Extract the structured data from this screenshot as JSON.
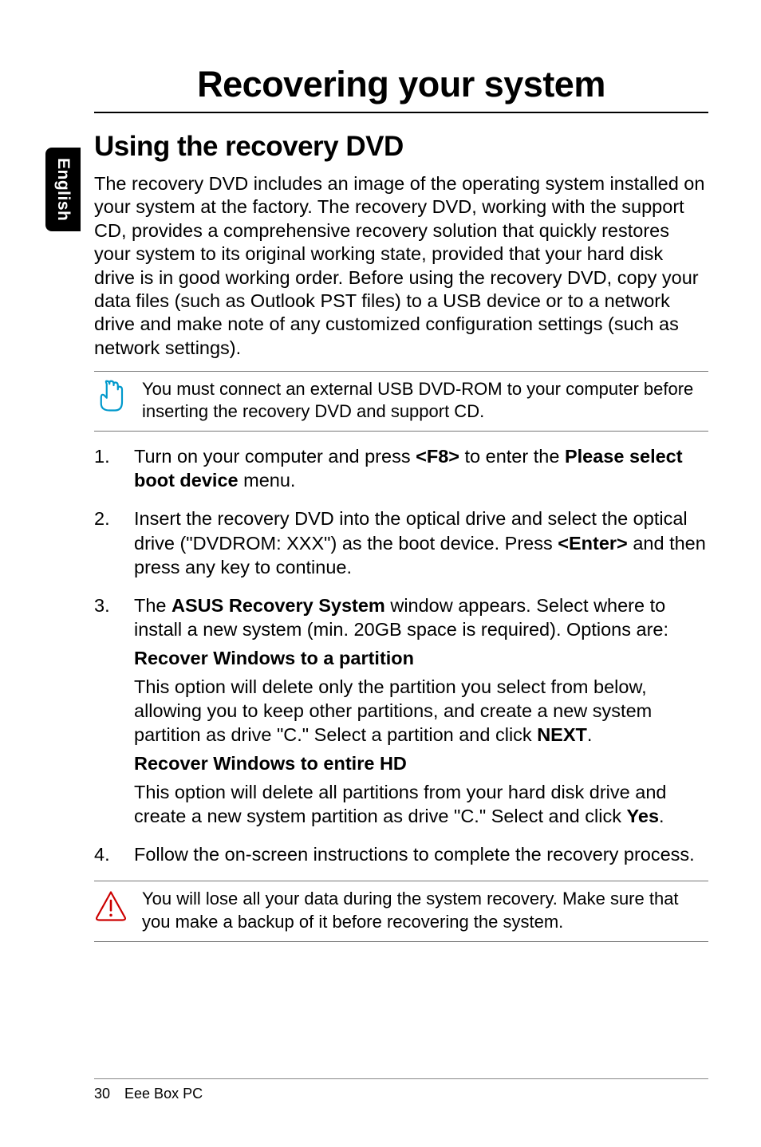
{
  "side_tab": "English",
  "chapter_title": "Recovering your system",
  "section_title": "Using the recovery DVD",
  "intro": "The recovery DVD includes an image of the operating system installed on your system at the factory. The recovery DVD, working with the support CD, provides a comprehensive recovery solution that quickly restores your system to its original working state, provided that your hard disk drive is in good working order. Before using the recovery DVD, copy your data files (such as Outlook PST files) to a USB device or to a network drive and make note of any customized configuration settings (such as network settings).",
  "note1": "You must connect an external USB DVD-ROM to your computer before inserting the recovery DVD and support CD.",
  "steps": {
    "s1": {
      "num": "1.",
      "pre": "Turn on your computer and press ",
      "key": "<F8>",
      "mid": " to enter the ",
      "menu": "Please select boot device",
      "post": " menu."
    },
    "s2": {
      "num": "2.",
      "pre": "Insert the recovery DVD into the optical drive and select the optical drive (\"DVDROM: XXX\") as the boot device. Press ",
      "key": "<Enter>",
      "post": " and then press any key to continue."
    },
    "s3": {
      "num": "3.",
      "pre": "The ",
      "win": "ASUS Recovery System",
      "post": " window appears. Select where to install a new system (min. 20GB space is required). Options are:",
      "opt1_title": "Recover Windows to a partition",
      "opt1_body_pre": "This option will delete only the partition you select from below, allowing you to keep other partitions, and create a new system partition as drive \"C.\" Select a partition and click ",
      "opt1_next": "NEXT",
      "opt1_body_post": ".",
      "opt2_title": "Recover Windows to entire HD",
      "opt2_body_pre": "This option will delete all partitions from your hard disk drive and create a new system partition as drive \"C.\" Select and click ",
      "opt2_yes": "Yes",
      "opt2_body_post": "."
    },
    "s4": {
      "num": "4.",
      "text": "Follow the on-screen instructions to complete the recovery process."
    }
  },
  "warning": "You will lose all your data during the system recovery. Make sure that you make a backup of it before recovering the system.",
  "footer": {
    "page": "30",
    "title": "Eee Box PC"
  }
}
